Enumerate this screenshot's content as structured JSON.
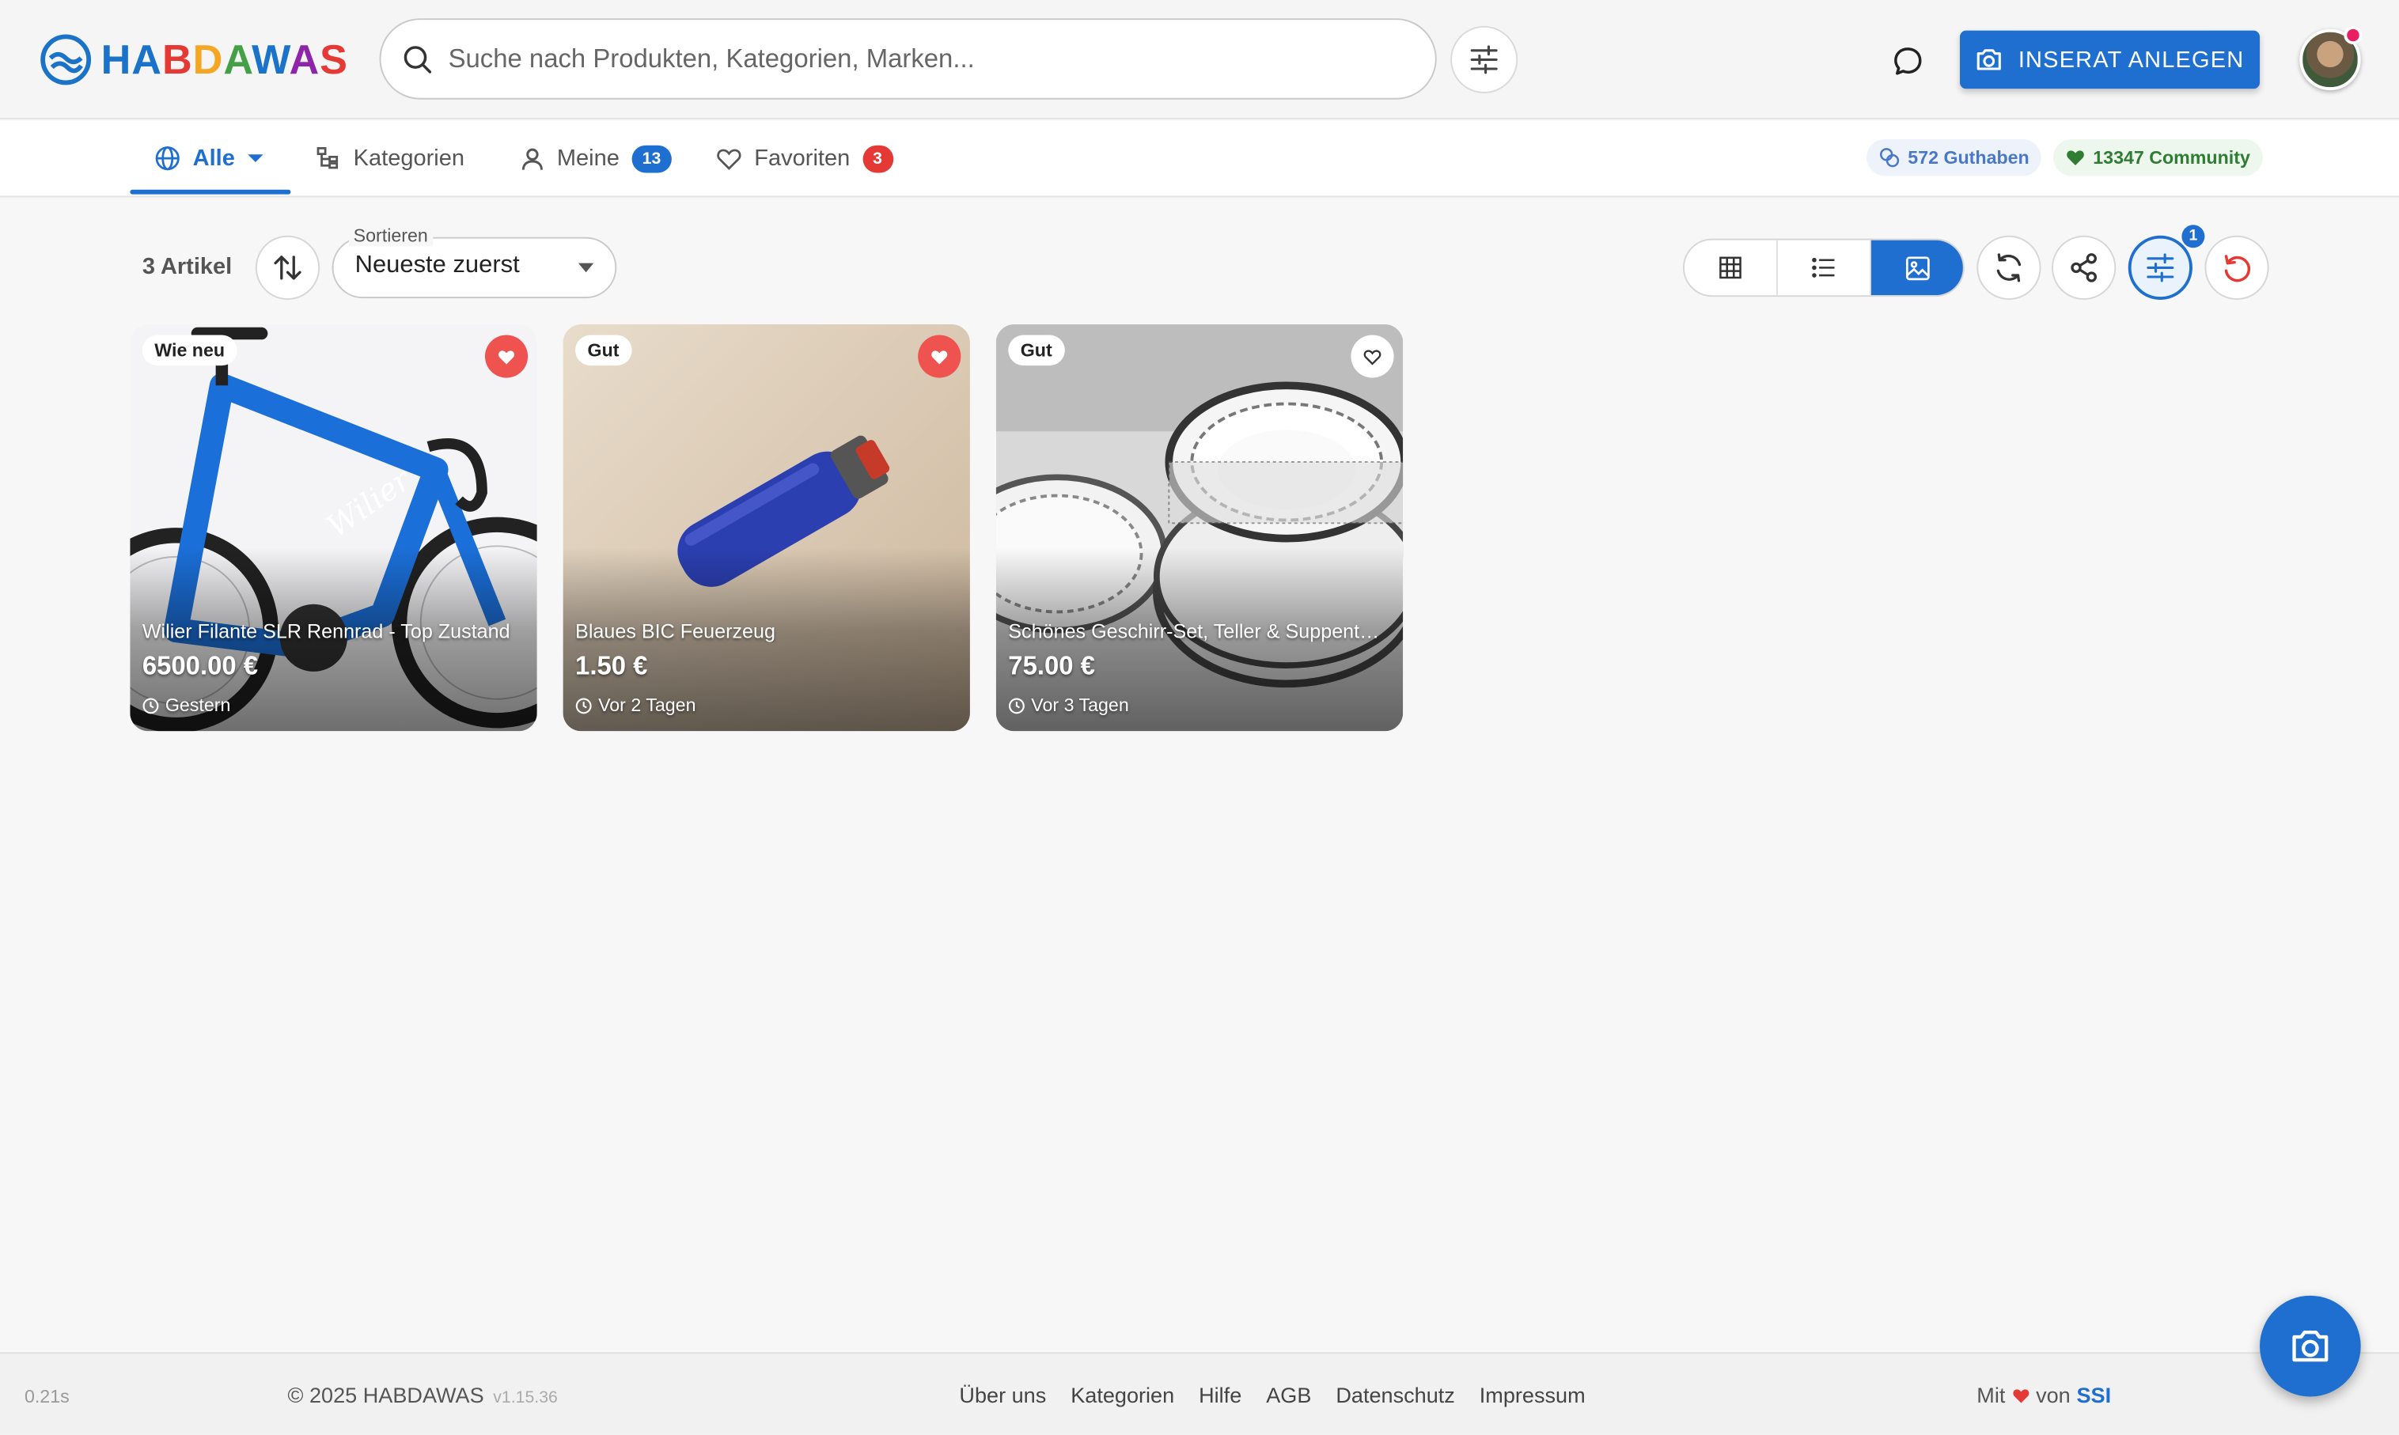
{
  "header": {
    "logo_text": "HABDAWAS",
    "search_placeholder": "Suche nach Produkten, Kategorien, Marken...",
    "cta_label": "INSERAT ANLEGEN"
  },
  "nav": {
    "tabs": [
      {
        "label": "Alle",
        "active": true
      },
      {
        "label": "Kategorien"
      },
      {
        "label": "Meine",
        "badge": "13"
      },
      {
        "label": "Favoriten",
        "badge": "3"
      }
    ],
    "credit": "572 Guthaben",
    "community": "13347 Community"
  },
  "toolbar": {
    "count": "3 Artikel",
    "sort_label": "Sortieren",
    "sort_value": "Neueste zuerst",
    "filter_badge": "1"
  },
  "items": [
    {
      "condition": "Wie neu",
      "title": "Wilier Filante SLR Rennrad - Top Zustand",
      "price": "6500.00 €",
      "time": "Gestern",
      "favorite": true
    },
    {
      "condition": "Gut",
      "title": "Blaues BIC Feuerzeug",
      "price": "1.50 €",
      "time": "Vor 2 Tagen",
      "favorite": true
    },
    {
      "condition": "Gut",
      "title": "Schönes Geschirr-Set, Teller & Suppenteller",
      "price": "75.00 €",
      "time": "Vor 3 Tagen",
      "favorite": false
    }
  ],
  "footer": {
    "timing": "0.21s",
    "copyright": "© 2025 HABDAWAS",
    "version": "v1.15.36",
    "links": [
      "Über uns",
      "Kategorien",
      "Hilfe",
      "AGB",
      "Datenschutz",
      "Impressum"
    ],
    "made_prefix": "Mit",
    "made_mid": "von",
    "made_brand": "SSI"
  },
  "colors": {
    "accent": "#1e6fd0",
    "favorite": "#ef5350",
    "community": "#2e7d32"
  }
}
